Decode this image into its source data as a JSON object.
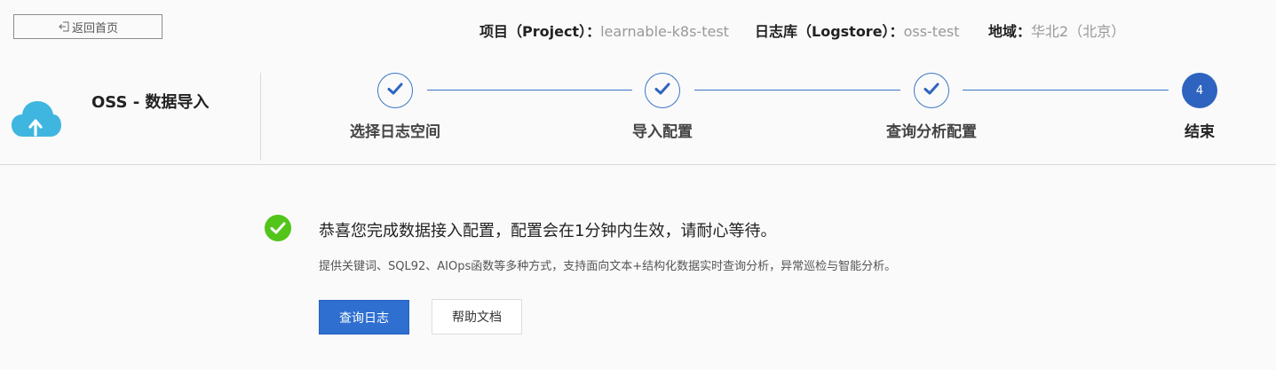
{
  "header": {
    "back_label": "返回首页",
    "project": {
      "label": "项目（Project）：",
      "value": "learnable-k8s-test"
    },
    "logstore": {
      "label": "日志库（Logstore）：",
      "value": "oss-test"
    },
    "region": {
      "label": "地域：",
      "value": "华北2（北京）"
    }
  },
  "wizard": {
    "title": "OSS - 数据导入",
    "steps": [
      {
        "label": "选择日志空间",
        "status": "done"
      },
      {
        "label": "导入配置",
        "status": "done"
      },
      {
        "label": "查询分析配置",
        "status": "done"
      },
      {
        "label": "结束",
        "status": "active",
        "number": "4"
      }
    ]
  },
  "result": {
    "title": "恭喜您完成数据接入配置，配置会在1分钟内生效，请耐心等待。",
    "description": "提供关键词、SQL92、AIOps函数等多种方式，支持面向文本+结构化数据实时查询分析，异常巡检与智能分析。",
    "primary_button": "查询日志",
    "secondary_button": "帮助文档"
  },
  "colors": {
    "accent": "#2e6fd0",
    "step_line": "#3b77c9",
    "success": "#52c41a",
    "cloud": "#3fb6e0"
  },
  "icons": {
    "back": "back-arrow-icon",
    "cloud": "cloud-upload-icon",
    "check": "check-icon",
    "success": "success-check-circle-icon"
  }
}
